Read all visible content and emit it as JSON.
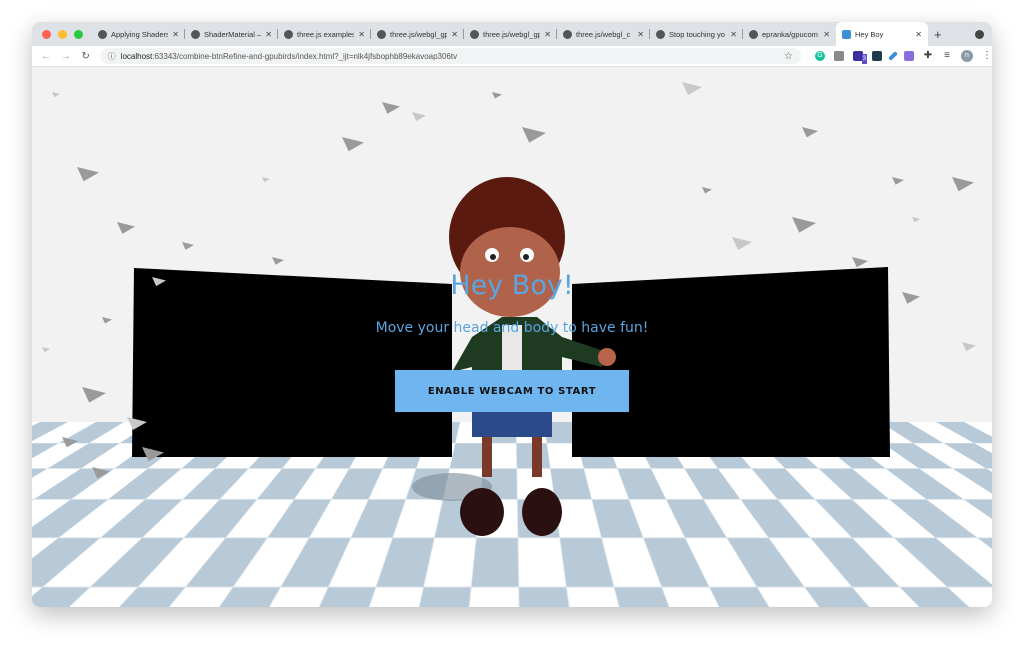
{
  "browser": {
    "tabs": [
      {
        "label": "Applying Shaders",
        "icon": "globe-icon"
      },
      {
        "label": "ShaderMaterial –",
        "icon": "threejs-icon"
      },
      {
        "label": "three.js examples",
        "icon": "threejs-icon"
      },
      {
        "label": "three.js/webgl_gp",
        "icon": "github-icon"
      },
      {
        "label": "three.js/webgl_gp",
        "icon": "github-icon"
      },
      {
        "label": "three.js/webgl_c",
        "icon": "github-icon"
      },
      {
        "label": "Stop touching yo",
        "icon": "video-icon"
      },
      {
        "label": "epranka/gpucom",
        "icon": "github-icon"
      },
      {
        "label": "Hey Boy",
        "icon": "app-icon",
        "active": true
      }
    ],
    "url_host": "localhost",
    "url_rest": ":63343/combine-btnRefine-and-gpubirds/index.html?_ijt=nlk4jfsbophb89ekavoap306tv",
    "profile_initial": "n",
    "extension_badge": "3"
  },
  "page": {
    "title": "Hey Boy!",
    "subtitle": "Move your head and body to have fun!",
    "button_label": "ENABLE WEBCAM TO START"
  },
  "colors": {
    "accent_text": "#5aa5e0",
    "button": "#6fb6f0",
    "floor_checker": "#b8cad8"
  }
}
